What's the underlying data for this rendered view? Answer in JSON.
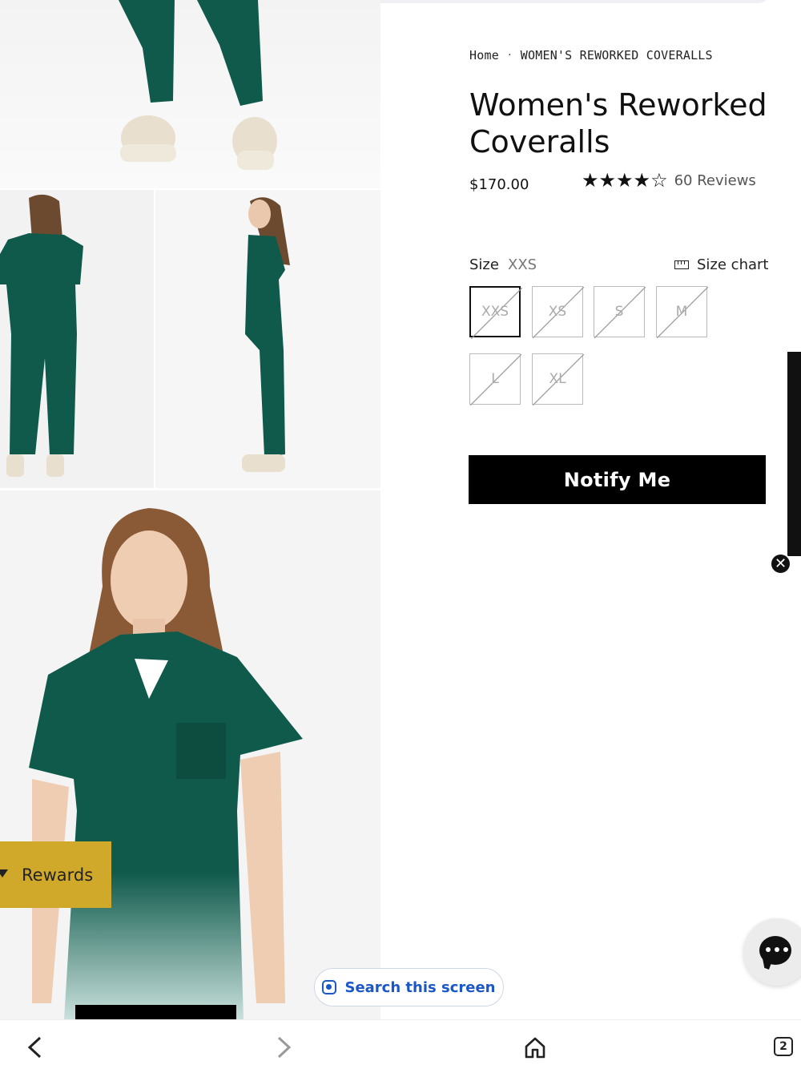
{
  "breadcrumb": {
    "home": "Home",
    "separator": "·",
    "current": "WOMEN'S REWORKED COVERALLS"
  },
  "product": {
    "title": "Women's Reworked Coveralls",
    "price": "$170.00",
    "rating": {
      "value": 4,
      "max": 5,
      "reviews_label": "60 Reviews"
    }
  },
  "size": {
    "label": "Size",
    "selected": "XXS",
    "chart_label": "Size chart",
    "options": [
      {
        "label": "XXS",
        "available": false,
        "selected": true
      },
      {
        "label": "XS",
        "available": false,
        "selected": false
      },
      {
        "label": "S",
        "available": false,
        "selected": false
      },
      {
        "label": "M",
        "available": false,
        "selected": false
      },
      {
        "label": "L",
        "available": false,
        "selected": false
      },
      {
        "label": "XL",
        "available": false,
        "selected": false
      }
    ]
  },
  "notify_button": "Notify Me",
  "rewards_label": "Rewards",
  "search_pill": "Search this screen",
  "tabs_count": "2",
  "colors": {
    "garment_green": "#0f5a4b",
    "rewards_gold": "#d1a92a",
    "accent_blue": "#1a57c8"
  },
  "icons": {
    "back": "chevron-left-icon",
    "forward": "chevron-right-icon",
    "home": "home-icon",
    "chat": "chat-icon",
    "close": "close-icon",
    "ruler": "ruler-icon"
  }
}
